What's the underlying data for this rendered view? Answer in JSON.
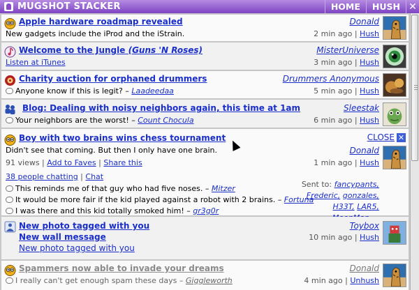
{
  "titlebar": {
    "app_name": "MUGSHOT STACKER",
    "home": "HOME",
    "hush": "HUSH",
    "close": "✕"
  },
  "items": [
    {
      "headline": "Apple hardware roadmap revealed",
      "desc": "New gadgets include the iProd and the iStrain.",
      "who": "Donald",
      "time": "2 min ago",
      "sep": " | ",
      "action": "Hush"
    },
    {
      "headline": "Welcome to the Jungle",
      "headline_extra": "(Guns 'N Roses)",
      "desc": "Listen at iTunes",
      "who": "MisterUniverse",
      "time": "3 min ago",
      "sep": " | ",
      "action": "Hush"
    },
    {
      "headline": "Charity auction for orphaned drummers",
      "desc": "Anyone know if this is legit? –",
      "desc_link": "Laadeedaa",
      "who": "Drummers Anonymous",
      "time": "5 min ago",
      "sep": " | ",
      "action": "Hush"
    },
    {
      "headline": "Blog: Dealing with noisy neighbors again, this time at 1am",
      "desc": "Your neighbors are the worst! –",
      "desc_link": "Count Chocula",
      "who": "Sleestak",
      "time": "6 min ago",
      "sep": " | ",
      "action": "Hush"
    },
    {
      "headline": "Boy with two brains wins chess tournament",
      "desc": "Didn't see that coming. But then I only have one brain.",
      "views": "91 views",
      "add_faves": "Add to Faves",
      "share": "Share this",
      "chatting": "38 people chatting",
      "chat": "Chat",
      "who": "Donald",
      "time": "1 min ago",
      "sep": " | ",
      "action": "Hush",
      "close": "CLOSE",
      "sent_to_label": "Sent to:",
      "sent_to": [
        "fancypants,",
        "Frederic,",
        "gonzales,",
        "H33T,",
        "LAR5,",
        "MoonMan",
        "..."
      ],
      "comments": [
        {
          "text": "This reminds me of that guy who had five noses. –",
          "author": "Mitzer"
        },
        {
          "text": "It would be more fair if the kid played against a robot with 2 brains. –",
          "author": "Fortuna"
        },
        {
          "text": "I was there and this kid totally smoked him! –",
          "author": "gr3g0r"
        }
      ]
    },
    {
      "headline": "New photo tagged with you",
      "headline2": "New wall message",
      "headline3": "New photo tagged with you",
      "who": "Toybox",
      "time": "10 min ago",
      "sep": " | ",
      "action": "Hush"
    },
    {
      "headline": "Spammers now able to invade your dreams",
      "desc": "I really can't get enough spam these days –",
      "desc_link": "Giggleworth",
      "who": "Donald",
      "time": "4 min ago",
      "sep": " | ",
      "action": "Unhush"
    }
  ]
}
